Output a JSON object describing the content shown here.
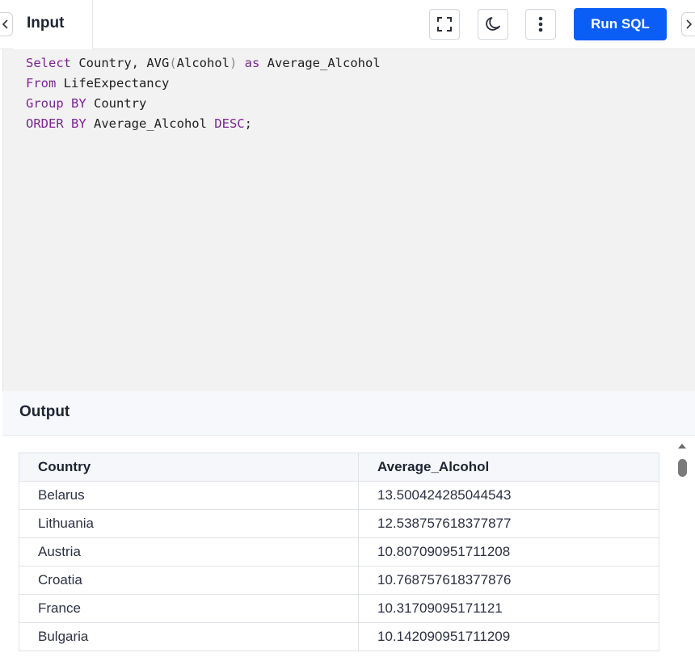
{
  "header": {
    "tab_label": "Input",
    "run_label": "Run SQL",
    "icons": [
      "fullscreen-icon",
      "moon-icon",
      "more-vertical-icon",
      "chevron-left-icon",
      "chevron-right-icon"
    ]
  },
  "editor": {
    "lines": [
      [
        "Select",
        " Country, AVG",
        "(",
        "Alcohol",
        ")",
        " as",
        " Average_Alcohol"
      ],
      [
        "From",
        " LifeExpectancy"
      ],
      [
        "Group BY",
        " Country"
      ],
      [
        "ORDER BY",
        " Average_Alcohol ",
        "DESC",
        ";"
      ]
    ]
  },
  "output": {
    "title": "Output",
    "columns": [
      "Country",
      "Average_Alcohol"
    ],
    "rows": [
      [
        "Belarus",
        "13.500424285044543"
      ],
      [
        "Lithuania",
        "12.538757618377877"
      ],
      [
        "Austria",
        "10.807090951711208"
      ],
      [
        "Croatia",
        "10.768757618377876"
      ],
      [
        "France",
        "10.31709095171121"
      ],
      [
        "Bulgaria",
        "10.142090951711209"
      ]
    ]
  },
  "colors": {
    "accent": "#0a5ef5",
    "keyword": "#7d2394",
    "editor_bg": "#f2f2f2"
  }
}
